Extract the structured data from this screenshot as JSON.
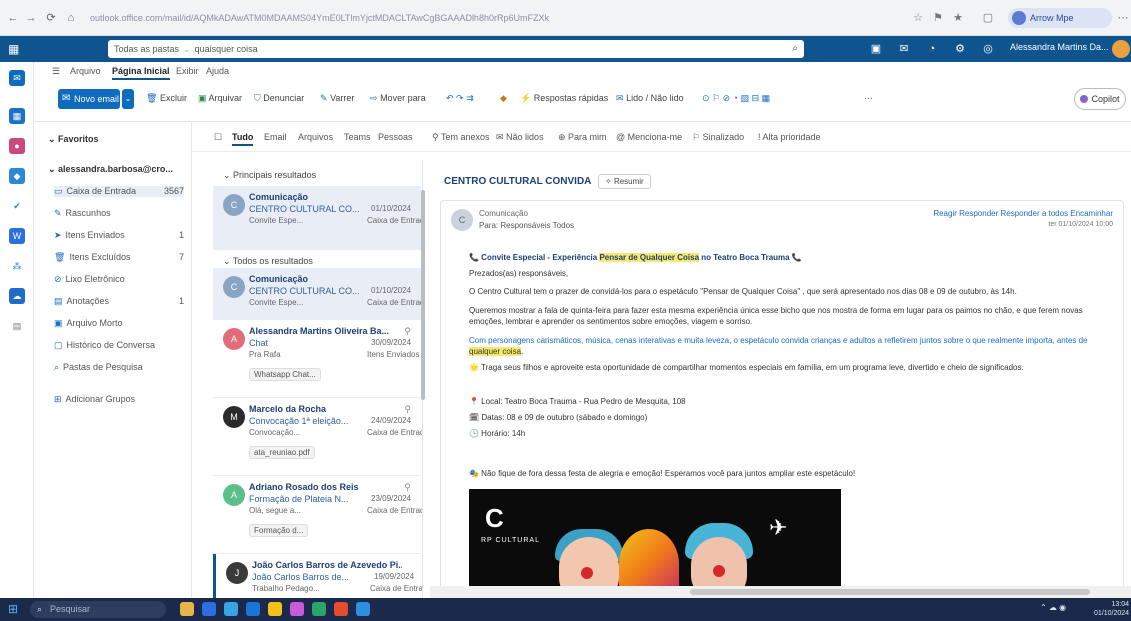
{
  "browser": {
    "url": "outlook.office.com/mail/id/AQMkADAwATM0MDAAMS04YmE0LTlmYjctMDACLTAwCgBGAAADlh8h0rRp6UmFZXk",
    "profile_label": "Arrow Mpe",
    "nav_back": "←",
    "nav_forward": "→",
    "nav_refresh": "⟳",
    "nav_home": "⌂"
  },
  "topbar": {
    "scope_label": "Todas as pastas",
    "search_placeholder": "Pesquisar",
    "search_query": "quaisquer coisa",
    "user_name": "Alessandra Martins Da..."
  },
  "tabs": [
    "Arquivo",
    "Página Inicial",
    "Exibir",
    "Ajuda"
  ],
  "ribbon": {
    "new_mail": "Novo email",
    "buttons": [
      "Excluir",
      "Arquivar",
      "Denunciar",
      "Varrer",
      "Mover para",
      "Respostas rápidas",
      "Lido / Não lido"
    ],
    "copilot": "Copilot"
  },
  "folders": {
    "favorites_header": "Favoritos",
    "account": "alessandra.barbosa@cro...",
    "items": [
      {
        "label": "Caixa de Entrada",
        "count": "3567"
      },
      {
        "label": "Rascunhos",
        "count": ""
      },
      {
        "label": "Itens Enviados",
        "count": "1"
      },
      {
        "label": "Itens Excluídos",
        "count": "7"
      },
      {
        "label": "Lixo Eletrônico",
        "count": ""
      },
      {
        "label": "Anotações",
        "count": "1"
      },
      {
        "label": "Arquivo Morto",
        "count": ""
      },
      {
        "label": "Histórico de Conversa",
        "count": ""
      },
      {
        "label": "Pastas de Pesquisa",
        "count": ""
      }
    ],
    "add_group": "Adicionar Grupos"
  },
  "filters": [
    "Tudo",
    "Email",
    "Arquivos",
    "Teams",
    "Pessoas",
    "Tem anexos",
    "Não lidos",
    "Para mim",
    "Menciona-me",
    "Sinalizado",
    "Alta prioridade"
  ],
  "list": {
    "top_header": "Principais resultados",
    "all_header": "Todos os resultados",
    "messages": [
      {
        "from": "Comunicação",
        "subject": "CENTRO CULTURAL CO...",
        "date": "01/10/2024",
        "preview": "Convite Espe...",
        "folder": "Caixa de Entrada",
        "chip": "",
        "avatar": "C",
        "avatar_color": "#8aa4c4"
      },
      {
        "from": "Comunicação",
        "subject": "CENTRO CULTURAL CO...",
        "date": "01/10/2024",
        "preview": "Convite Espe...",
        "folder": "Caixa de Entrada",
        "chip": "",
        "avatar": "C",
        "avatar_color": "#8aa4c4"
      },
      {
        "from": "Alessandra Martins Oliveira Ba...",
        "subject": "Chat",
        "date": "30/09/2024",
        "preview": "Pra Rafa",
        "folder": "Itens Enviados",
        "chip": "Whatsapp Chat...",
        "avatar": "A",
        "avatar_color": "#e26d7a"
      },
      {
        "from": "Marcelo da Rocha",
        "subject": "Convocação 1ª eleição...",
        "date": "24/09/2024",
        "preview": "Convocação...",
        "folder": "Caixa de Entrada",
        "chip": "ata_reuniao.pdf",
        "avatar": "M",
        "avatar_color": "#2b2b2b"
      },
      {
        "from": "Adriano Rosado dos Reis",
        "subject": "Formação de Plateia N...",
        "date": "23/09/2024",
        "preview": "Olá, segue a...",
        "folder": "Caixa de Entrada",
        "chip": "Formação d...",
        "avatar": "A",
        "avatar_color": "#5cbf8a"
      },
      {
        "from": "João Carlos Barros de Azevedo Pi...",
        "subject": "João Carlos Barros de...",
        "date": "19/09/2024",
        "preview": "Trabalho Pedago...",
        "folder": "Caixa de Entrada",
        "chip": "",
        "avatar": "J",
        "avatar_color": "#3a3a3a"
      }
    ]
  },
  "reading": {
    "subject": "CENTRO CULTURAL CONVIDA",
    "summarize": "Resumir",
    "sender": "Comunicação",
    "recipients": "Para: Responsáveis Todos",
    "actions": "Reagir   Responder   Responder a todos   Encaminhar",
    "date": "ter 01/10/2024 10:00",
    "body": {
      "headline_pre": "📞 Convite Especial - Experiência ",
      "headline_mark": "Pensar de Qualquer Coisa",
      "headline_post": " no Teatro Boca Trauma 📞",
      "greeting": "Prezados(as) responsáveis,",
      "p1": "O Centro Cultural tem o prazer de convidá-los para o espetáculo \"Pensar de Qualquer Coisa\" , que será apresentado nos dias 08 e 09 de outubro, às 14h.",
      "p2": "Queremos mostrar a fala de quinta-feira para fazer esta mesma experiência única esse bicho que nos mostra de forma em lugar para os paimos no chão, e que ferem novas emoções, lembrar e aprender os sentimentos sobre emoções, viagem e sorriso.",
      "p3_pre": "Com personagens carismáticos, música, cenas interativas e muita leveza, o espetáculo convida crianças e adultos a refletirem juntos sobre o que realmente importa, antes de ",
      "p3_mark": "qualquer coisa",
      "p3_post": ".",
      "p4": "🌟 Traga seus filhos e aproveite esta oportunidade de compartilhar momentos especiais em família, em um programa leve, divertido e cheio de significados.",
      "local": "📍 Local: Teatro Boca Trauma - Rua Pedro de Mesquita, 108",
      "datas": "🗓 Datas: 08 e 09 de outubro (sábado e domingo)",
      "horario": "🕒 Horário: 14h",
      "closing": "🎭 Não fique de fora dessa festa de alegria e emoção! Esperamos você para juntos ampliar este espetáculo!"
    },
    "poster_brand": "RP CULTURAL"
  },
  "taskbar": {
    "search_placeholder": "Pesquisar",
    "time": "13:04",
    "date": "01/10/2024",
    "apps": [
      "#e8b44a",
      "#2d6fe0",
      "#3aa4e0",
      "#1877d4",
      "#f2c21b",
      "#c95ad8",
      "#2ba66a",
      "#e84a2f",
      "#2d8fe0"
    ]
  }
}
